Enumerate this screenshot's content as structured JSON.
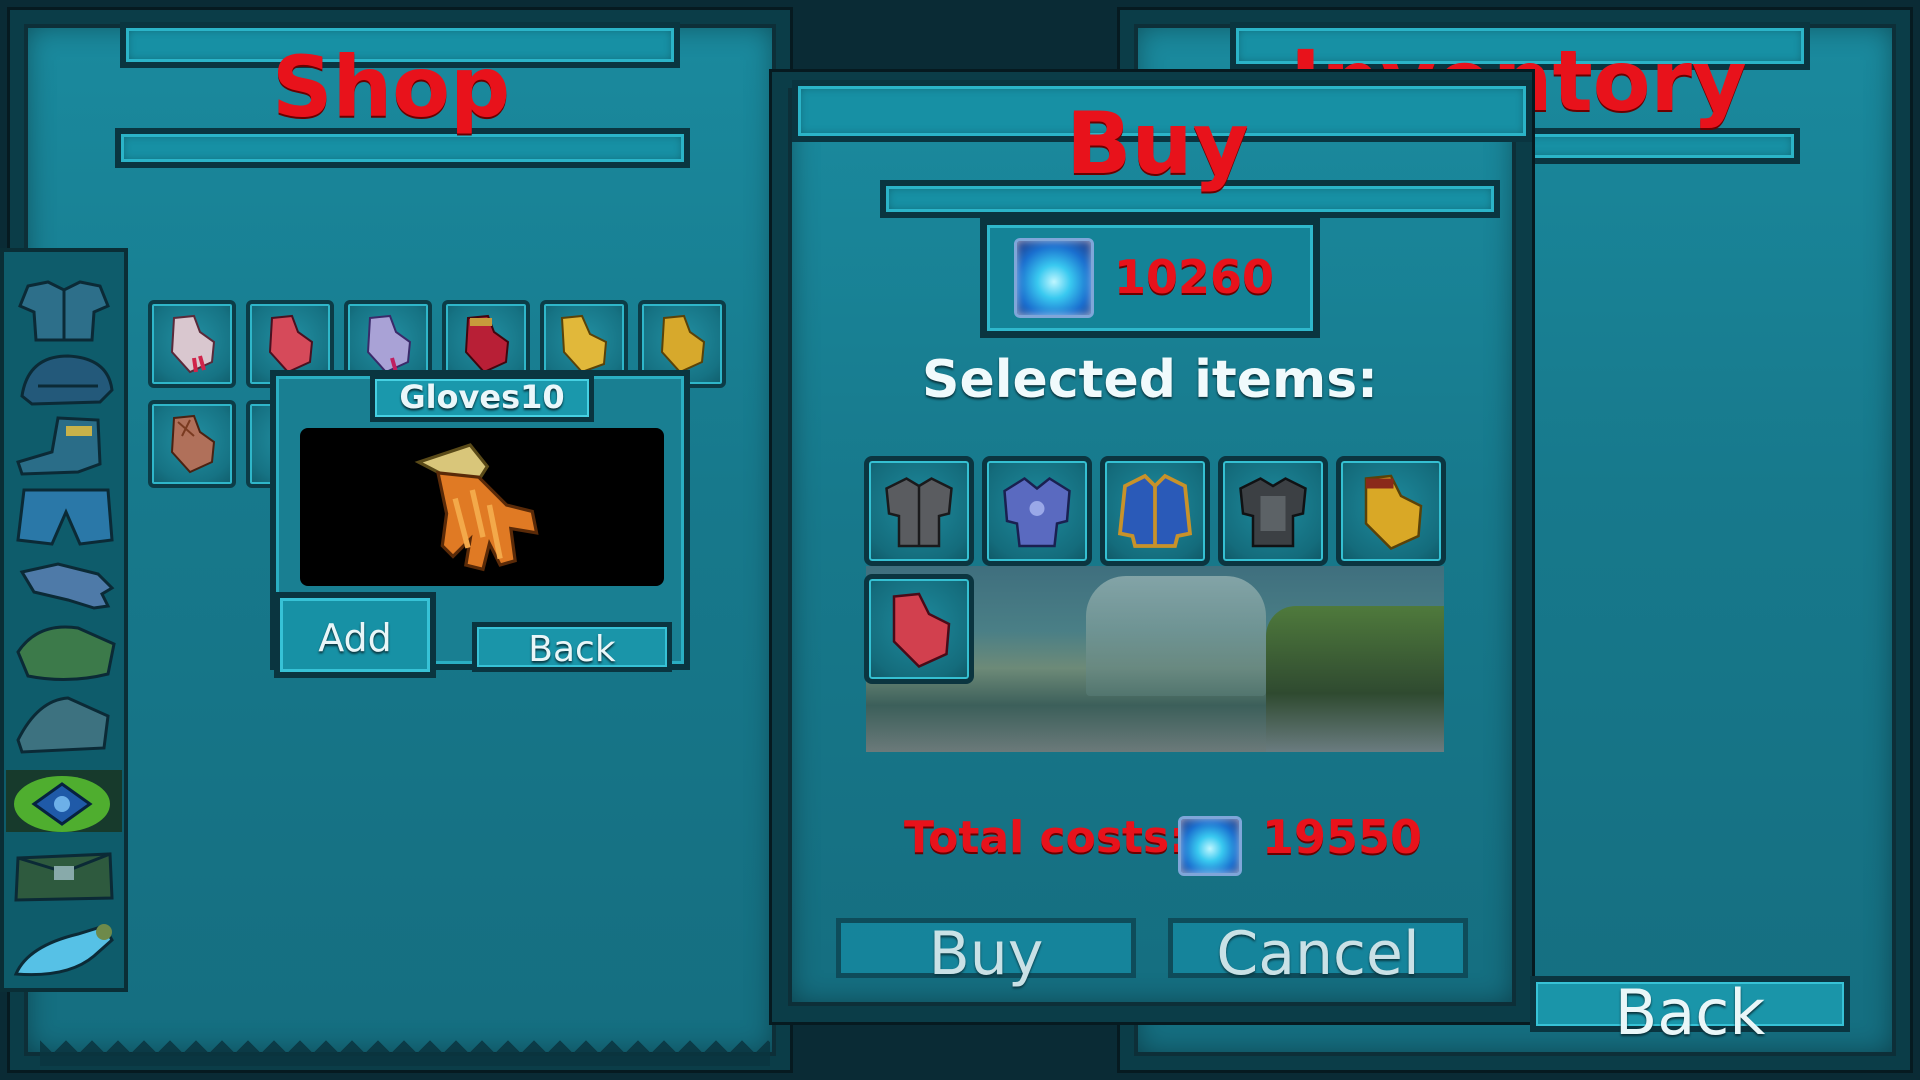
{
  "shop": {
    "title": "Shop"
  },
  "inventory": {
    "title": "Inventory",
    "back_label": "Back"
  },
  "shop_grid": {
    "row1": [
      "gloves-white-pink",
      "gloves-red",
      "gloves-lavender",
      "gloves-crimson",
      "gloves-gold-a",
      "gloves-gold-b"
    ],
    "row2": [
      "gloves-leather-lace"
    ]
  },
  "categories": [
    "chest-armor",
    "helmet",
    "boots",
    "pants",
    "gloves",
    "bracer",
    "shoulder",
    "amulet",
    "bag",
    "potion"
  ],
  "item_popup": {
    "name": "Gloves10",
    "add_label": "Add",
    "back_label": "Back"
  },
  "buy_dialog": {
    "title": "Buy",
    "balance": "10260",
    "selected_label": "Selected items:",
    "selected_items": [
      "chest-dark",
      "chest-blue",
      "jacket-blue-gold",
      "chest-steel",
      "gloves-gold",
      "gloves-red"
    ],
    "total_label": "Total costs:",
    "total_value": "19550",
    "buy_label": "Buy",
    "cancel_label": "Cancel"
  },
  "colors": {
    "panel": "#17798c",
    "title_red": "#e8121b",
    "frame_dark": "#0b3d48"
  }
}
